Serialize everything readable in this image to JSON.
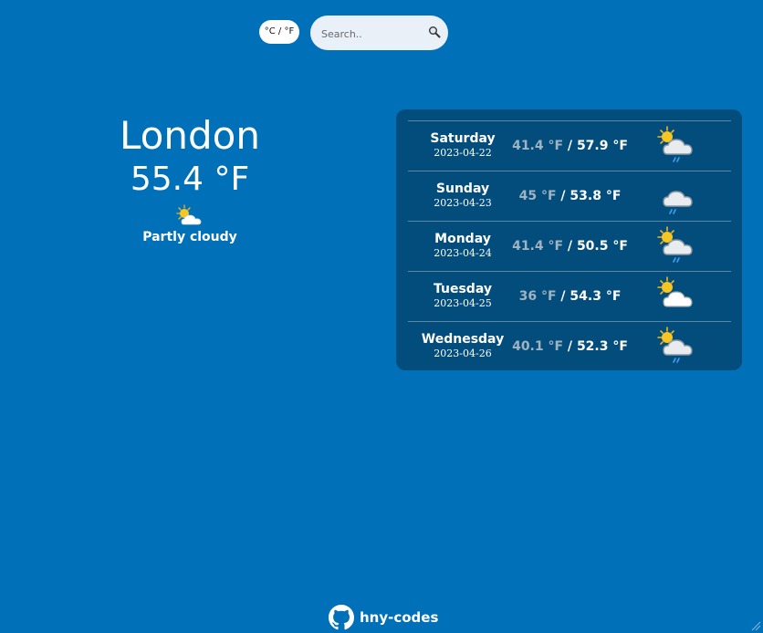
{
  "header": {
    "unit_toggle_label": "°C / °F",
    "search_placeholder": "Search..",
    "search_value": ""
  },
  "current": {
    "city": "London",
    "temperature": "55.4 °F",
    "condition": "Partly cloudy",
    "icon": "partly-cloudy-icon"
  },
  "forecast": [
    {
      "day": "Saturday",
      "date": "2023-04-22",
      "low": "41.4 °F",
      "high": "57.9 °F",
      "separator": " / ",
      "icon": "sun-cloud-rain-icon"
    },
    {
      "day": "Sunday",
      "date": "2023-04-23",
      "low": "45 °F",
      "high": "53.8 °F",
      "separator": " / ",
      "icon": "cloud-rain-icon"
    },
    {
      "day": "Monday",
      "date": "2023-04-24",
      "low": "41.4 °F",
      "high": "50.5 °F",
      "separator": " / ",
      "icon": "sun-cloud-rain-icon"
    },
    {
      "day": "Tuesday",
      "date": "2023-04-25",
      "low": "36 °F",
      "high": "54.3 °F",
      "separator": " / ",
      "icon": "sun-cloud-icon"
    },
    {
      "day": "Wednesday",
      "date": "2023-04-26",
      "low": "40.1 °F",
      "high": "52.3 °F",
      "separator": " / ",
      "icon": "sun-cloud-rain-icon"
    }
  ],
  "footer": {
    "label": "hny-codes",
    "icon": "github-icon"
  },
  "colors": {
    "background": "#0070b8",
    "panel": "#034d7c",
    "low_temp": "#9fb3c2"
  }
}
